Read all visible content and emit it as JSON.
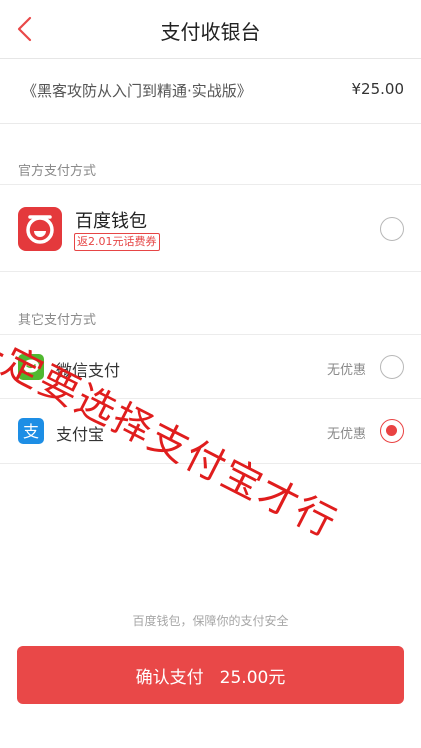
{
  "header": {
    "title": "支付收银台"
  },
  "order": {
    "product_name": "《黑客攻防从入门到精通·实战版》",
    "price": "¥25.00"
  },
  "official_section": {
    "label": "官方支付方式",
    "baidu_wallet": {
      "name": "百度钱包",
      "promo": "返2.01元话费券",
      "selected": false
    }
  },
  "other_section": {
    "label": "其它支付方式",
    "methods": [
      {
        "name": "微信支付",
        "note": "无优惠",
        "selected": false,
        "icon": "wechat-pay-icon",
        "color": "#50b830"
      },
      {
        "name": "支付宝",
        "note": "无优惠",
        "selected": true,
        "icon": "alipay-icon",
        "color": "#1d8ee5"
      }
    ]
  },
  "footer": {
    "security_note": "百度钱包，保障你的支付安全",
    "confirm_label": "确认支付",
    "confirm_amount": "25.00元"
  },
  "annotation": {
    "text": "一定要选择支付宝才行"
  },
  "colors": {
    "accent": "#e94848",
    "baidu_red": "#e4393c"
  }
}
